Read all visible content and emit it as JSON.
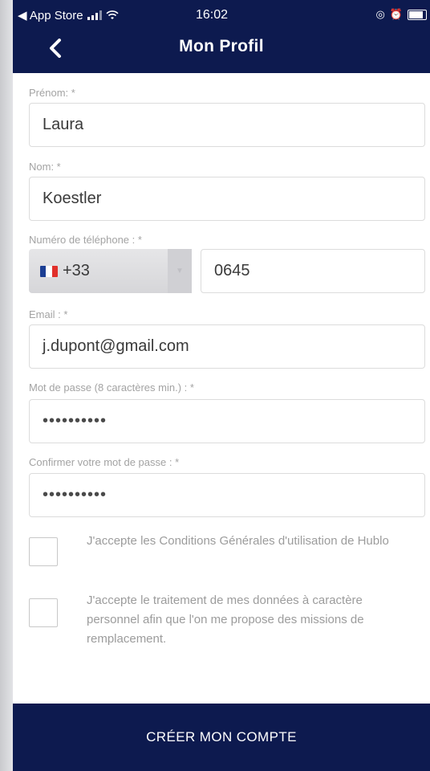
{
  "status_bar": {
    "back_app": "◀ App Store",
    "time": "16:02"
  },
  "header": {
    "title": "Mon Profil",
    "back_icon": "chevron-left-icon"
  },
  "form": {
    "first_name": {
      "label": "Prénom: *",
      "value": "Laura"
    },
    "last_name": {
      "label": "Nom: *",
      "value": "Koestler"
    },
    "phone": {
      "label": "Numéro de téléphone : *",
      "country_code": "+33",
      "number": "0645",
      "flag": "france-flag-icon"
    },
    "email": {
      "label": "Email : *",
      "value": "j.dupont@gmail.com"
    },
    "password": {
      "label": "Mot de passe (8 caractères min.) : *",
      "value": "••••••••••"
    },
    "confirm_password": {
      "label": "Confirmer votre mot de passe : *",
      "value": "••••••••••"
    },
    "terms_checkbox": {
      "label": "J'accepte les Conditions Générales d'utilisation de Hublo",
      "checked": false
    },
    "data_checkbox": {
      "label": "J'accepte le traitement de mes données à caractère personnel afin que l'on me propose des missions de remplacement.",
      "checked": false
    }
  },
  "submit_button": {
    "label": "CRÉER MON COMPTE"
  },
  "colors": {
    "primary": "#0d1a4f",
    "label": "#a3a3a3",
    "border": "#dcdcdc"
  }
}
